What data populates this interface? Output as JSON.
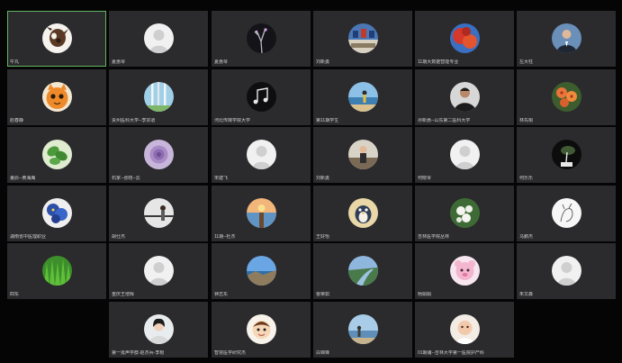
{
  "meeting": {
    "participants": [
      {
        "name": "牛丸",
        "avatar": "pug-dog-avatar",
        "active": true
      },
      {
        "name": "夏惠琴",
        "avatar": "default-person-icon"
      },
      {
        "name": "夏惠琴",
        "avatar": "bare-branch-night-avatar"
      },
      {
        "name": "刘新勇",
        "avatar": "blue-flag-building-avatar"
      },
      {
        "name": "11期大数据智能专业",
        "avatar": "red-autumn-leaves-avatar"
      },
      {
        "name": "左大柱",
        "avatar": "man-in-suit-avatar"
      },
      {
        "name": "赵春静",
        "avatar": "orange-cartoon-cat-avatar"
      },
      {
        "name": "贵州医科大学--李宗道",
        "avatar": "birch-trees-avatar"
      },
      {
        "name": "河北传媒学院大学",
        "avatar": "music-notes-avatar"
      },
      {
        "name": "第11期学生",
        "avatar": "seaside-figure-avatar"
      },
      {
        "name": "孙新惠--山东第二医科大学",
        "avatar": "man-portrait-avatar"
      },
      {
        "name": "林先桐",
        "avatar": "orange-flowers-avatar"
      },
      {
        "name": "董辰--黄海鹰",
        "avatar": "green-plant-avatar"
      },
      {
        "name": "石家--张晓--云",
        "avatar": "purple-rose-avatar"
      },
      {
        "name": "宋建飞",
        "avatar": "default-person-icon"
      },
      {
        "name": "刘新勇",
        "avatar": "person-in-room-avatar"
      },
      {
        "name": "何晓琴",
        "avatar": "default-person-icon"
      },
      {
        "name": "何乐乐",
        "avatar": "dark-bonsai-avatar"
      },
      {
        "name": "湖南省中医理职业",
        "avatar": "blue-flowers-avatar"
      },
      {
        "name": "胡仕杰",
        "avatar": "woman-at-railing-avatar"
      },
      {
        "name": "11期--杜杰",
        "avatar": "sunset-pier-avatar"
      },
      {
        "name": "王好怡",
        "avatar": "cartoon-bird-avatar"
      },
      {
        "name": "吉林医学院丛林",
        "avatar": "white-blossoms-avatar"
      },
      {
        "name": "马鹏杰",
        "avatar": "line-drawing-avatar"
      },
      {
        "name": "四东",
        "avatar": "green-grass-avatar"
      },
      {
        "name": "重庆王增辉",
        "avatar": "default-person-icon"
      },
      {
        "name": "钟志东",
        "avatar": "blue-sky-coast-avatar"
      },
      {
        "name": "曹荣如",
        "avatar": "river-landscape-avatar"
      },
      {
        "name": "杨娟娟",
        "avatar": "pink-cartoon-avatar"
      },
      {
        "name": "朱又森",
        "avatar": "default-person-icon"
      },
      {
        "name": "第一批声学群-赵杰兵-李根",
        "avatar": "woman-portrait-avatar"
      },
      {
        "name": "智慧医学研究杰",
        "avatar": "cartoon-face-avatar"
      },
      {
        "name": "白锦锋",
        "avatar": "lakeside-person-avatar"
      },
      {
        "name": "01期诸--吉林大学第一医院护产科",
        "avatar": "baby-avatar"
      }
    ]
  },
  "colors": {
    "tile_bg": "#2b2b2d",
    "active_border": "#62b562",
    "page_bg": "#050505",
    "name_text": "#cfcfcf"
  }
}
